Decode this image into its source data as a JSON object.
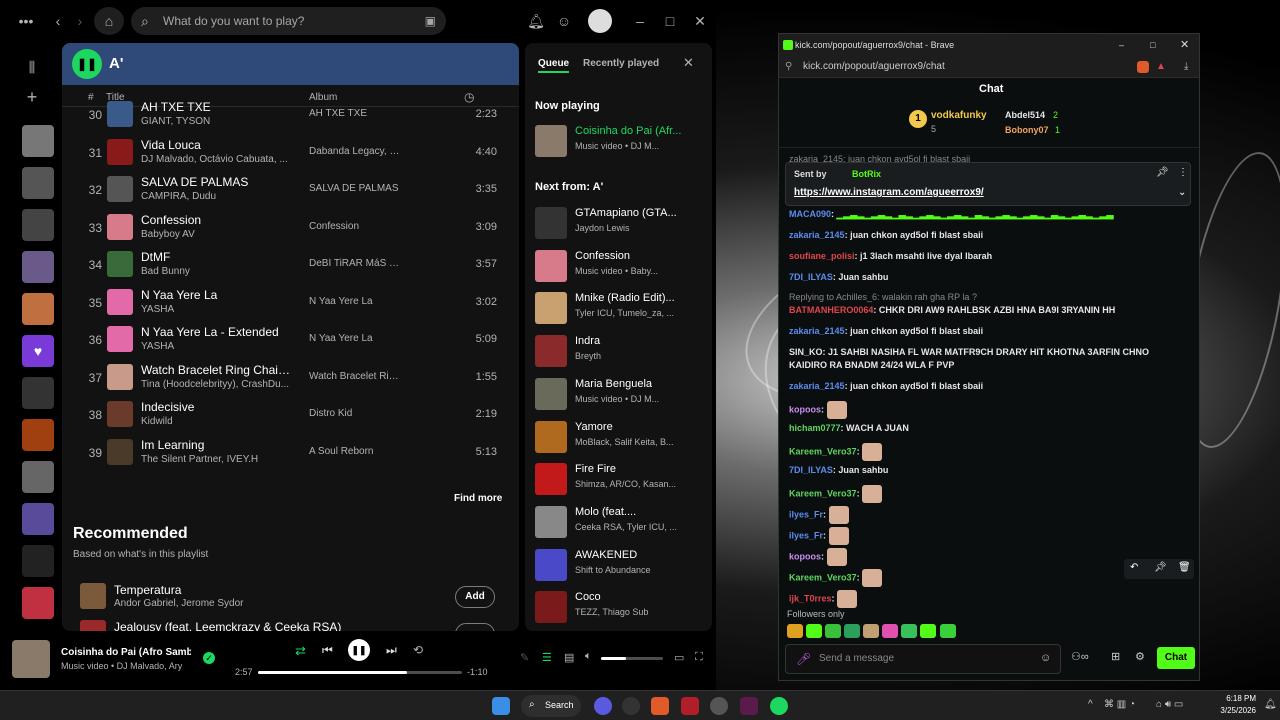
{
  "spotify": {
    "search_placeholder": "What do you want to play?",
    "playlist_title": "A'",
    "col_num": "#",
    "col_title": "Title",
    "col_album": "Album",
    "tracks": [
      {
        "num": "30",
        "title": "AH TXE TXE",
        "artist": "GIANT, TYSON",
        "album": "AH TXE TXE",
        "duration": "2:23",
        "color": "#3a5a8a"
      },
      {
        "num": "31",
        "title": "Vida Louca",
        "artist": "DJ Malvado, Octávio Cabuata, ...",
        "album": "Dabanda Legacy, Vol.1",
        "duration": "4:40",
        "color": "#8a1a1a"
      },
      {
        "num": "32",
        "title": "SALVA DE PALMAS",
        "artist": "CAMPIRA, Dudu",
        "album": "SALVA DE PALMAS",
        "duration": "3:35",
        "color": "#555"
      },
      {
        "num": "33",
        "title": "Confession",
        "artist": "Babyboy AV",
        "album": "Confession",
        "duration": "3:09",
        "color": "#d77a8a"
      },
      {
        "num": "34",
        "title": "DtMF",
        "artist": "Bad Bunny",
        "album": "DeBÍ TiRAR MáS FOT...",
        "duration": "3:57",
        "color": "#3a6a3a"
      },
      {
        "num": "35",
        "title": "N Yaa Yere La",
        "artist": "YASHA",
        "album": "N Yaa Yere La",
        "duration": "3:02",
        "color": "#e26aa8"
      },
      {
        "num": "36",
        "title": "N Yaa Yere La - Extended",
        "artist": "YASHA",
        "album": "N Yaa Yere La",
        "duration": "5:09",
        "color": "#e26aa8"
      },
      {
        "num": "37",
        "title": "Watch Bracelet Ring Chain (W...",
        "artist": "Tina (Hoodcelebrityy), CrashDu...",
        "album": "Watch Bracelet Ring ...",
        "duration": "1:55",
        "color": "#c79a8a"
      },
      {
        "num": "38",
        "title": "Indecisive",
        "artist": "Kidwild",
        "album": "Distro Kid",
        "duration": "2:19",
        "color": "#6a3a2a"
      },
      {
        "num": "39",
        "title": "Im Learning",
        "artist": "The Silent Partner, IVEY.H",
        "album": "A Soul Reborn",
        "duration": "5:13",
        "color": "#4a3a2a"
      }
    ],
    "find_more": "Find more",
    "recommended_title": "Recommended",
    "recommended_sub": "Based on what's in this playlist",
    "rec_items": [
      {
        "title": "Temperatura",
        "artist": "Andor Gabriel, Jerome Sydor",
        "add": "Add"
      },
      {
        "title": "Jealousy (feat. Leemckrazy & Ceeka RSA)",
        "artist": "",
        "add": ""
      }
    ],
    "queue_tab": "Queue",
    "recent_tab": "Recently played",
    "now_playing_label": "Now playing",
    "now_playing": {
      "title": "Coisinha do Pai (Afr...",
      "sub": "Music video • DJ M..."
    },
    "next_from_label": "Next from: A'",
    "queue": [
      {
        "title": "GTAmapiano (GTA...",
        "sub": "Jaydon Lewis",
        "color": "#333"
      },
      {
        "title": "Confession",
        "sub": "Music video • Baby...",
        "color": "#d77a8a"
      },
      {
        "title": "Mnike (Radio Edit)...",
        "sub": "Tyler ICU, Tumelo_za, ...",
        "color": "#c9a070"
      },
      {
        "title": "Indra",
        "sub": "Breyth",
        "color": "#8a2a2a"
      },
      {
        "title": "Maria Benguela",
        "sub": "Music video • DJ M...",
        "color": "#6a6a5a"
      },
      {
        "title": "Yamore",
        "sub": "MoBlack, Salif Keita, B...",
        "color": "#b06a20"
      },
      {
        "title": "Fire Fire",
        "sub": "Shimza, AR/CO, Kasan...",
        "color": "#c21a1a"
      },
      {
        "title": "Molo (feat....",
        "sub": "Ceeka RSA, Tyler ICU, ...",
        "color": "#888"
      },
      {
        "title": "AWAKENED",
        "sub": "Shift to Abundance",
        "color": "#4a4ac8"
      },
      {
        "title": "Coco",
        "sub": "TEZZ, Thiago Sub",
        "color": "#7a1a1a"
      }
    ],
    "player": {
      "title": "Coisinha do Pai (Afro Samba Mi",
      "sub": "Music video • DJ Malvado, Ary",
      "elapsed": "2:57",
      "remaining": "-1:10",
      "progress_fraction": 0.73,
      "volume_fraction": 0.4
    }
  },
  "kick": {
    "window_title": "kick.com/popout/aguerrox9/chat - Brave",
    "url": "kick.com/popout/aguerrox9/chat",
    "chat_heading": "Chat",
    "leaders": [
      {
        "name": "vodkafunky",
        "count": "5",
        "color": "#f2c94c"
      },
      {
        "name": "Abdel514",
        "count": "2",
        "color": "#e6e6e6"
      },
      {
        "name": "Bobony07",
        "count": "1",
        "color": "#f0a35e"
      }
    ],
    "leader_rank": "1",
    "pinned_cut": "zakaria_2145: juan chkon ayd5ol fi blast sbaii",
    "pinned_by": "Sent by",
    "pinned_bot": "BotRix",
    "pinned_link": "https://www.instagram.com/agueerrox9/",
    "reply_note": "Replying to Achilles_6: walakin rah gha RP la ?",
    "messages": [
      {
        "user": "MACA090",
        "color": "#5b8def",
        "text": ""
      },
      {
        "user": "zakaria_2145",
        "color": "#5b8def",
        "text": "juan chkon ayd5ol fi blast sbaii"
      },
      {
        "user": "soufiane_polisi",
        "color": "#e0464b",
        "text": "j1 3lach msahti live dyal lbarah"
      },
      {
        "user": "7DI_ILYAS",
        "color": "#5b8def",
        "text": "Juan sahbu"
      },
      {
        "user": "BATMANHERO0064",
        "color": "#e0464b",
        "text": "CHKR DRI AW9 RAHLBSK AZBI HNA BA9I 3RYANIN HH"
      },
      {
        "user": "zakaria_2145",
        "color": "#5b8def",
        "text": "juan chkon ayd5ol fi blast sbaii"
      },
      {
        "user": "SIN_KO",
        "color": "#e6e6e6",
        "text": "J1 SAHBI NASIHA FL WAR MATFR9CH DRARY HIT KHOTNA 3ARFIN CHNO KAIDIRO RA BNADM 24/24 WLA F PVP"
      },
      {
        "user": "zakaria_2145",
        "color": "#5b8def",
        "text": "juan chkon ayd5ol fi blast sbaii"
      },
      {
        "user": "kopoos",
        "color": "#c98ef0",
        "text": ""
      },
      {
        "user": "hicham0777",
        "color": "#5ed65e",
        "text": "WACH A JUAN"
      },
      {
        "user": "Kareem_Vero37",
        "color": "#5ed65e",
        "text": ""
      },
      {
        "user": "7DI_ILYAS",
        "color": "#5b8def",
        "text": "Juan sahbu"
      },
      {
        "user": "Kareem_Vero37",
        "color": "#5ed65e",
        "text": ""
      },
      {
        "user": "ilyes_Fr",
        "color": "#5b8def",
        "text": ""
      },
      {
        "user": "ilyes_Fr",
        "color": "#5b8def",
        "text": ""
      },
      {
        "user": "kopoos",
        "color": "#c98ef0",
        "text": ""
      },
      {
        "user": "Kareem_Vero37",
        "color": "#5ed65e",
        "text": ""
      },
      {
        "user": "ijk_T0rres",
        "color": "#e0464b",
        "text": ""
      }
    ],
    "followers_only": "Followers only",
    "send_placeholder": "Send a message",
    "chat_button": "Chat"
  },
  "taskbar": {
    "search": "Search",
    "time": "6:18 PM",
    "date": "3/25/2026"
  },
  "colors": {
    "spotify_green": "#1ed760",
    "kick_green": "#53fc18"
  },
  "icons": [
    "home-icon",
    "search-icon",
    "bell-icon",
    "friends-icon",
    "shuffle-icon",
    "prev-icon",
    "pause-icon",
    "next-icon",
    "repeat-icon",
    "volume-icon",
    "close-icon",
    "download-icon"
  ]
}
